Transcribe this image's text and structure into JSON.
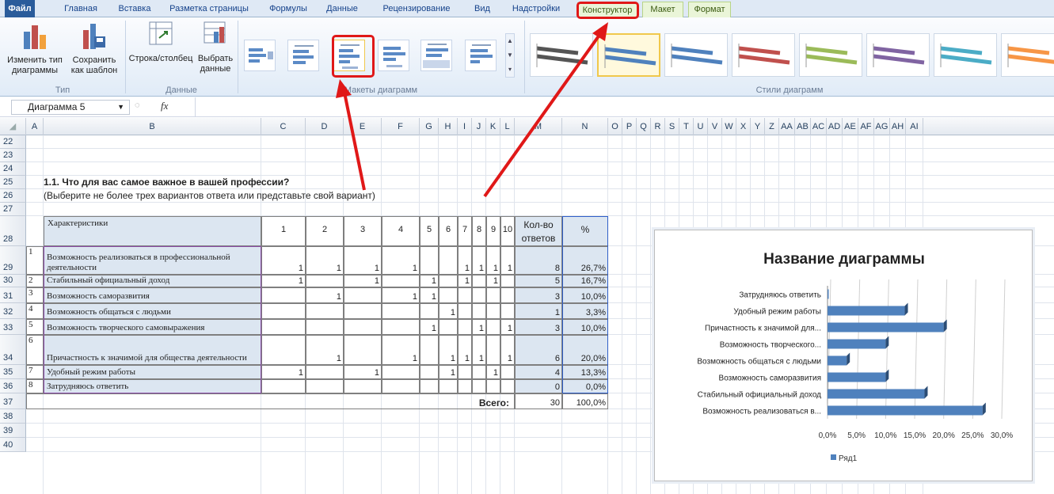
{
  "ribbon_tabs": [
    "Файл",
    "Главная",
    "Вставка",
    "Разметка страницы",
    "Формулы",
    "Данные",
    "Рецензирование",
    "Вид",
    "Надстройки",
    "Конструктор",
    "Макет",
    "Формат"
  ],
  "ribbon": {
    "change_type": "Изменить тип диаграммы",
    "save_template": "Сохранить как шаблон",
    "group_type": "Тип",
    "switch_row_col": "Строка/столбец",
    "select_data": "Выбрать данные",
    "group_data": "Данные",
    "group_layouts": "Макеты диаграмм",
    "group_styles": "Стили диаграмм",
    "style_colors": [
      "#555555",
      "#4f81bd",
      "#4f81bd",
      "#c0504d",
      "#9bbb59",
      "#8064a2",
      "#4bacc6",
      "#f79646"
    ]
  },
  "formula_bar": {
    "name_box": "Диаграмма 5",
    "fx": "fx"
  },
  "columns": [
    "A",
    "B",
    "C",
    "D",
    "E",
    "F",
    "G",
    "H",
    "I",
    "J",
    "K",
    "L",
    "M",
    "N",
    "O",
    "P",
    "Q",
    "R",
    "S",
    "T",
    "U",
    "V",
    "W",
    "X",
    "Y",
    "Z",
    "AA",
    "AB",
    "AC",
    "AD",
    "AE",
    "AF",
    "AG",
    "AH",
    "AI"
  ],
  "rows": [
    "22",
    "23",
    "24",
    "25",
    "26",
    "27",
    "28",
    "29",
    "30",
    "31",
    "32",
    "33",
    "34",
    "35",
    "36",
    "37",
    "38",
    "39",
    "40"
  ],
  "sheet": {
    "question": "1.1. Что для вас самое важное в вашей профессии?",
    "subtitle": "(Выберите не более трех вариантов ответа или представьте свой вариант)",
    "header": {
      "char": "Характеристики",
      "cols": [
        "1",
        "2",
        "3",
        "4",
        "5",
        "6",
        "7",
        "8",
        "9",
        "10"
      ],
      "count": "Кол-во ответов",
      "pct": "%"
    },
    "rows": [
      {
        "n": "1",
        "name": "Возможность реализоваться в профессиональной деятельности",
        "v": [
          "1",
          "1",
          "1",
          "1",
          "",
          "",
          "1",
          "1",
          "1",
          "1"
        ],
        "count": "8",
        "pct": "26,7%"
      },
      {
        "n": "2",
        "name": "Стабильный официальный доход",
        "v": [
          "1",
          "",
          "1",
          "",
          "1",
          "",
          "1",
          "",
          "1",
          ""
        ],
        "count": "5",
        "pct": "16,7%"
      },
      {
        "n": "3",
        "name": "Возможность саморазвития",
        "v": [
          "",
          "1",
          "",
          "1",
          "1",
          "",
          "",
          "",
          "",
          ""
        ],
        "count": "3",
        "pct": "10,0%"
      },
      {
        "n": "4",
        "name": "Возможность общаться с людьми",
        "v": [
          "",
          "",
          "",
          "",
          "",
          "1",
          "",
          "",
          "",
          ""
        ],
        "count": "1",
        "pct": "3,3%"
      },
      {
        "n": "5",
        "name": "Возможность творческого самовыражения",
        "v": [
          "",
          "",
          "",
          "",
          "1",
          "",
          "",
          "1",
          "",
          "1"
        ],
        "count": "3",
        "pct": "10,0%"
      },
      {
        "n": "6",
        "name": "Причастность к значимой для общества деятельности",
        "v": [
          "",
          "1",
          "",
          "1",
          "",
          "1",
          "1",
          "1",
          "",
          "1"
        ],
        "count": "6",
        "pct": "20,0%"
      },
      {
        "n": "7",
        "name": "Удобный режим работы",
        "v": [
          "1",
          "",
          "1",
          "",
          "",
          "1",
          "",
          "",
          "1",
          ""
        ],
        "count": "4",
        "pct": "13,3%"
      },
      {
        "n": "8",
        "name": "Затрудняюсь ответить",
        "v": [
          "",
          "",
          "",
          "",
          "",
          "",
          "",
          "",
          "",
          ""
        ],
        "count": "0",
        "pct": "0,0%"
      }
    ],
    "total_label": "Всего:",
    "total_count": "30",
    "total_pct": "100,0%"
  },
  "chart_data": {
    "type": "bar",
    "title": "Название диаграммы",
    "categories": [
      "Возможность реализоваться в...",
      "Стабильный официальный доход",
      "Возможность саморазвития",
      "Возможность общаться с людьми",
      "Возможность творческого...",
      "Причастность к значимой для...",
      "Удобный режим работы",
      "Затрудняюсь ответить"
    ],
    "series": [
      {
        "name": "Ряд1",
        "values": [
          0.267,
          0.167,
          0.1,
          0.033,
          0.1,
          0.2,
          0.133,
          0.0
        ]
      }
    ],
    "xlim": [
      0,
      0.3
    ],
    "xticks": [
      "0,0%",
      "5,0%",
      "10,0%",
      "15,0%",
      "20,0%",
      "25,0%",
      "30,0%"
    ],
    "legend_position": "bottom",
    "color": "#4f81bd"
  }
}
